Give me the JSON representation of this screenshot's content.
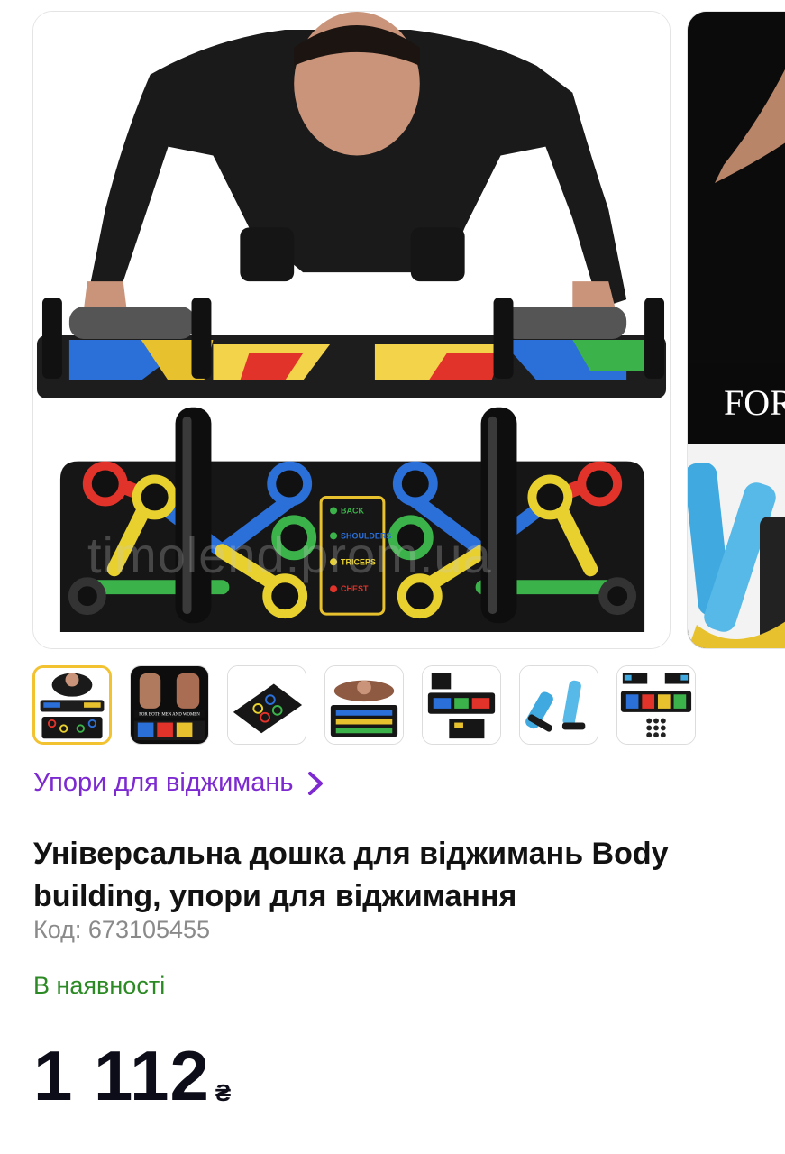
{
  "gallery": {
    "watermark": "timolend.prom.ua",
    "next_photo_label": "FOR",
    "main_board_labels": {
      "back": "BACK",
      "shoulders": "SHOULDERS",
      "triceps": "TRICEPS",
      "chest": "CHEST"
    }
  },
  "thumbnails": [
    {
      "label": "",
      "active": true
    },
    {
      "label": "FOR BOTH MEN AND WOMEN",
      "active": false
    },
    {
      "label": "",
      "active": false
    },
    {
      "label": "",
      "active": false
    },
    {
      "label": "",
      "active": false
    },
    {
      "label": "",
      "active": false
    },
    {
      "label": "",
      "active": false
    }
  ],
  "category": {
    "label": "Упори для віджимань"
  },
  "product": {
    "title": "Універсальна дошка для віджимань Body building, упори для віджимання",
    "code": "Код: 673105455",
    "availability": "В наявності",
    "price": "1 112",
    "currency": "₴"
  },
  "colors": {
    "accent": "#7d2ad1",
    "in_stock": "#2c8a24",
    "active_thumb_border": "#f2c230"
  }
}
